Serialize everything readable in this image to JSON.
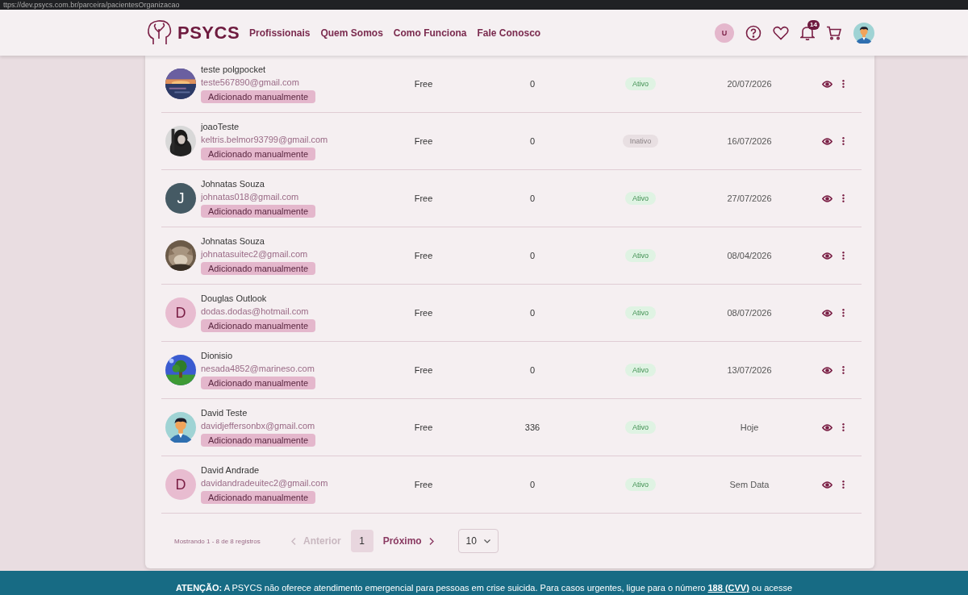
{
  "browser": {
    "url": "ttps://dev.psycs.com.br/parceira/pacientesOrganizacao"
  },
  "header": {
    "brand": "PSYCS",
    "nav": [
      "Profissionais",
      "Quem Somos",
      "Como Funciona",
      "Fale Conosco"
    ],
    "user_initial": "U",
    "notifications": "14"
  },
  "patients": [
    {
      "name": "teste polgpocket",
      "email": "teste567890@gmail.com",
      "tag": "Adicionado manualmente",
      "plan": "Free",
      "count": "0",
      "status": "Ativo",
      "active": true,
      "date": "20/07/2026"
    },
    {
      "name": "joaoTeste",
      "email": "keltris.belmor93799@gmail.com",
      "tag": "Adicionado manualmente",
      "plan": "Free",
      "count": "0",
      "status": "Inativo",
      "active": false,
      "date": "16/07/2026"
    },
    {
      "name": "Johnatas Souza",
      "email": "johnatas018@gmail.com",
      "tag": "Adicionado manualmente",
      "plan": "Free",
      "count": "0",
      "status": "Ativo",
      "active": true,
      "date": "27/07/2026",
      "avatar": {
        "kind": "letter",
        "letter": "J",
        "color": "#455a64"
      }
    },
    {
      "name": "Johnatas Souza",
      "email": "johnatasuitec2@gmail.com",
      "tag": "Adicionado manualmente",
      "plan": "Free",
      "count": "0",
      "status": "Ativo",
      "active": true,
      "date": "08/04/2026"
    },
    {
      "name": "Douglas Outlook",
      "email": "dodas.dodas@hotmail.com",
      "tag": "Adicionado manualmente",
      "plan": "Free",
      "count": "0",
      "status": "Ativo",
      "active": true,
      "date": "08/07/2026",
      "avatar": {
        "kind": "letter",
        "letter": "D",
        "color": "#e8bcd0"
      }
    },
    {
      "name": "Dionisio",
      "email": "nesada4852@marineso.com",
      "tag": "Adicionado manualmente",
      "plan": "Free",
      "count": "0",
      "status": "Ativo",
      "active": true,
      "date": "13/07/2026"
    },
    {
      "name": "David Teste",
      "email": "davidjeffersonbx@gmail.com",
      "tag": "Adicionado manualmente",
      "plan": "Free",
      "count": "336",
      "status": "Ativo",
      "active": true,
      "date": "Hoje",
      "avatar": {
        "kind": "illustration"
      }
    },
    {
      "name": "David Andrade",
      "email": "davidandradeuitec2@gmail.com",
      "tag": "Adicionado manualmente",
      "plan": "Free",
      "count": "0",
      "status": "Ativo",
      "active": true,
      "date": "Sem Data",
      "avatar": {
        "kind": "letter",
        "letter": "D",
        "color": "#e8bcd0"
      }
    }
  ],
  "pagination": {
    "summary": "Mostrando 1 - 8 de 8 registros",
    "previous": {
      "label": "Anterior",
      "disabled": true
    },
    "pages": [
      {
        "label": "1",
        "selected": true
      }
    ],
    "next": {
      "label": "Próximo",
      "disabled": false
    },
    "page_size": "10"
  },
  "notice": {
    "text": "**ATENÇÃO:** A PSYCS não oferece atendimento emergencial para pessoas em crise suicida. Para casos urgentes, ligue para o número",
    "link": "188 (CVV)",
    "after": "ou acesse"
  }
}
